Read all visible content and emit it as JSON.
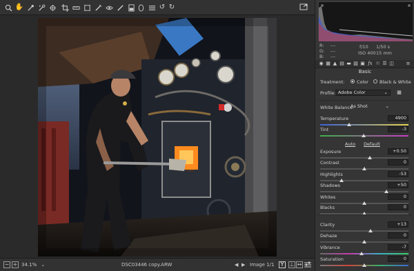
{
  "histogram": {
    "labels": {
      "r": "R:",
      "g": "G:",
      "b": "B:"
    },
    "placeholder": "---",
    "aperture": "f/10",
    "shutter": "1/50 s",
    "iso": "ISO 400",
    "focal": "15 mm"
  },
  "panel": {
    "section_title": "Basic",
    "treatment_label": "Treatment:",
    "treatment_options": [
      "Color",
      "Black & White"
    ],
    "treatment_selected": "Color",
    "profile_label": "Profile:",
    "profile_value": "Adobe Color",
    "white_balance_label": "White Balance:",
    "white_balance_value": "As Shot",
    "auto_label": "Auto",
    "default_label": "Default",
    "sliders": [
      {
        "label": "Temperature",
        "value": "4900",
        "pos": 0.33
      },
      {
        "label": "Tint",
        "value": "-3",
        "pos": 0.49
      },
      {
        "label": "Exposure",
        "value": "+0.50",
        "pos": 0.56
      },
      {
        "label": "Contrast",
        "value": "0",
        "pos": 0.5
      },
      {
        "label": "Highlights",
        "value": "-53",
        "pos": 0.24
      },
      {
        "label": "Shadows",
        "value": "+50",
        "pos": 0.75
      },
      {
        "label": "Whites",
        "value": "0",
        "pos": 0.5
      },
      {
        "label": "Blacks",
        "value": "0",
        "pos": 0.5
      },
      {
        "label": "Clarity",
        "value": "+13",
        "pos": 0.57
      },
      {
        "label": "Dehaze",
        "value": "0",
        "pos": 0.5
      },
      {
        "label": "Vibrance",
        "value": "-7",
        "pos": 0.47
      },
      {
        "label": "Saturation",
        "value": "0",
        "pos": 0.5
      }
    ]
  },
  "bottombar": {
    "zoom": "34.1%",
    "filename": "DSC03446 copy.ARW",
    "image_counter": "Image 1/1"
  },
  "colors": {
    "accent": "#d8d8d8",
    "panel_bg": "#353535",
    "toolbar_bg": "#323232"
  }
}
